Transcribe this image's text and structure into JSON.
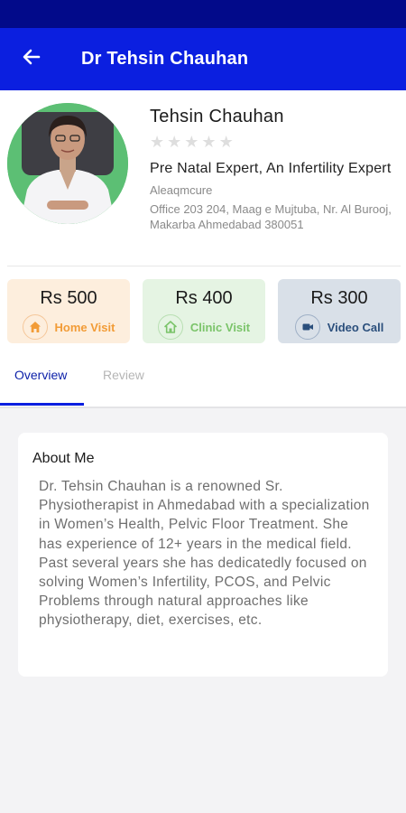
{
  "header": {
    "title": "Dr Tehsin Chauhan",
    "back_icon": "arrow-left-icon"
  },
  "profile": {
    "name": "Tehsin Chauhan",
    "rating": 0,
    "rating_max": 5,
    "specialty": "Pre Natal Expert, An Infertility Expert",
    "organization": "Aleaqmcure",
    "address": "Office 203 204, Maag e Mujtuba, Nr. Al Burooj, Makarba Ahmedabad 380051"
  },
  "fees": [
    {
      "price": "Rs 500",
      "label": "Home Visit",
      "icon": "home-icon"
    },
    {
      "price": "Rs 400",
      "label": "Clinic Visit",
      "icon": "clinic-icon"
    },
    {
      "price": "Rs 300",
      "label": "Video Call",
      "icon": "video-camera-icon"
    }
  ],
  "tabs": [
    {
      "label": "Overview",
      "active": true
    },
    {
      "label": "Review",
      "active": false
    }
  ],
  "about": {
    "title": "About Me",
    "text": "Dr. Tehsin Chauhan is a renowned Sr. Physiotherapist in Ahmedabad with a specialization in Women’s Health, Pelvic Floor Treatment. She has experience of 12+ years in the medical field. Past several years she has dedicatedly focused on solving Women’s Infertility, PCOS, and Pelvic Problems through natural approaches like physiotherapy, diet, exercises, etc."
  },
  "colors": {
    "status_bar": "#020a8a",
    "app_bar": "#0b1fe0",
    "home_accent": "#f29c37",
    "clinic_accent": "#7bc46a",
    "video_accent": "#2b4f7c"
  }
}
